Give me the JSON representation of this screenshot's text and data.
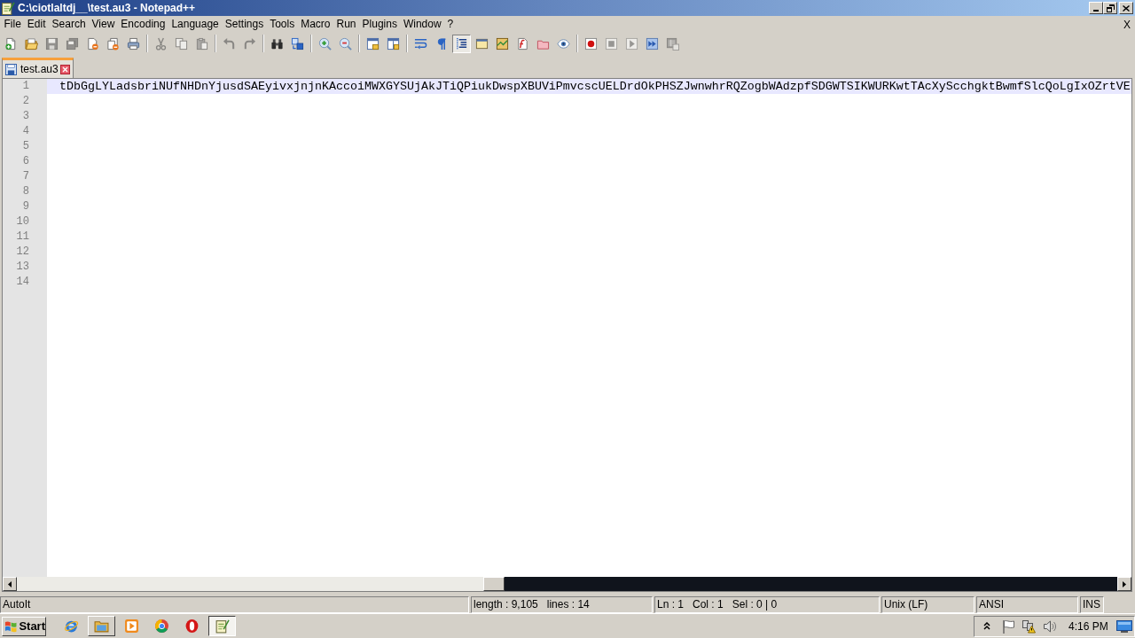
{
  "window": {
    "title": "C:\\ciotlaltdj__\\test.au3 - Notepad++"
  },
  "menu": {
    "items": [
      "File",
      "Edit",
      "Search",
      "View",
      "Encoding",
      "Language",
      "Settings",
      "Tools",
      "Macro",
      "Run",
      "Plugins",
      "Window",
      "?"
    ],
    "close_document": "X"
  },
  "toolbar": [
    {
      "disabled": false,
      "checked": false
    },
    {
      "disabled": false,
      "checked": false
    },
    {
      "disabled": true,
      "checked": false
    },
    {
      "disabled": true,
      "checked": false
    },
    {
      "disabled": false,
      "checked": false
    },
    {
      "disabled": false,
      "checked": false
    },
    {
      "disabled": false,
      "checked": false
    },
    {
      "disabled": true,
      "checked": false
    },
    {
      "disabled": true,
      "checked": false
    },
    {
      "disabled": true,
      "checked": false
    },
    {
      "disabled": true,
      "checked": false
    },
    {
      "disabled": true,
      "checked": false
    },
    {
      "disabled": false,
      "checked": false
    },
    {
      "disabled": false,
      "checked": false
    },
    {
      "disabled": false,
      "checked": false
    },
    {
      "disabled": false,
      "checked": false
    },
    {
      "disabled": false,
      "checked": false
    },
    {
      "disabled": false,
      "checked": false
    },
    {
      "disabled": false,
      "checked": false
    },
    {
      "disabled": false,
      "checked": false
    },
    {
      "disabled": false,
      "checked": true
    },
    {
      "disabled": false,
      "checked": false
    },
    {
      "disabled": false,
      "checked": false
    },
    {
      "disabled": false,
      "checked": false
    },
    {
      "disabled": false,
      "checked": false
    },
    {
      "disabled": false,
      "checked": false
    },
    {
      "disabled": false,
      "checked": false
    },
    {
      "disabled": true,
      "checked": false
    },
    {
      "disabled": true,
      "checked": false
    },
    {
      "disabled": false,
      "checked": false
    },
    {
      "disabled": true,
      "checked": false
    }
  ],
  "tabs": [
    {
      "label": "test.au3",
      "selected": true
    }
  ],
  "editor": {
    "lines": [
      {
        "number": "1",
        "text": "tDbGgLYLadsbriNUfNHDnYjusdSAEyivxjnjnKAccoiMWXGYSUjAkJTiQPiukDwspXBUViPmvcscUELDrdOkPHSZJwnwhrRQZogbWAdzpfSDGWTSIKWURKwtTAcXyScchgktBwmfSlcQoLgIxOZrtVE",
        "current": true
      },
      {
        "number": "2",
        "current": false
      },
      {
        "number": "3",
        "current": false
      },
      {
        "number": "4",
        "current": false
      },
      {
        "number": "5",
        "current": false
      },
      {
        "number": "6",
        "current": false
      },
      {
        "number": "7",
        "current": false
      },
      {
        "number": "8",
        "current": false
      },
      {
        "number": "9",
        "current": false
      },
      {
        "number": "10",
        "current": false
      },
      {
        "number": "11",
        "current": false
      },
      {
        "number": "12",
        "current": false
      },
      {
        "number": "13",
        "current": false
      },
      {
        "number": "14",
        "current": false
      }
    ]
  },
  "status_bar": [
    {
      "texts": [
        "AutoIt"
      ]
    },
    {
      "texts": [
        "length : 9,105",
        "lines : 14"
      ]
    },
    {
      "texts": [
        "Ln : 1",
        "Col : 1",
        "Sel : 0 | 0"
      ]
    },
    {
      "texts": [
        "Unix (LF)"
      ]
    },
    {
      "texts": [
        "ANSI"
      ]
    },
    {
      "texts": [
        "INS"
      ]
    }
  ],
  "taskbar": {
    "start": "Start",
    "apps": [
      {
        "kind": "quick_launch",
        "selected": false
      },
      {
        "kind": "window",
        "selected": false
      },
      {
        "kind": "quick_launch",
        "selected": false
      },
      {
        "kind": "quick_launch",
        "selected": false
      },
      {
        "kind": "quick_launch",
        "selected": false
      },
      {
        "kind": "window",
        "selected": true
      }
    ],
    "clock": "4:16 PM"
  }
}
